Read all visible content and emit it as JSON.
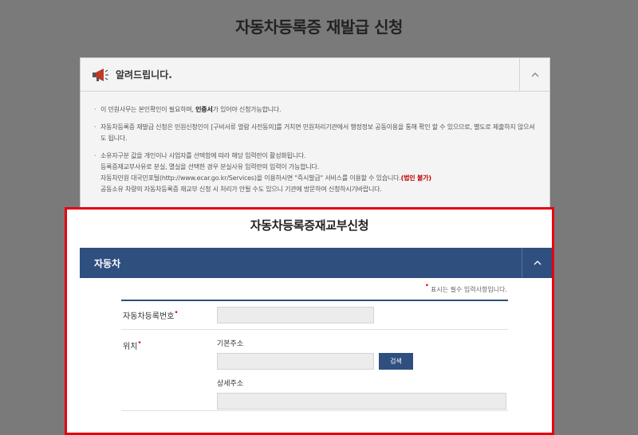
{
  "page": {
    "title": "자동차등록증 재발급 신청"
  },
  "notice": {
    "title": "알려드립니다.",
    "items": [
      {
        "pre": "이 민원사무는 본인확인이 필요하며, ",
        "bold": "인증서",
        "post": "가 있어야 신청가능합니다."
      },
      {
        "text": "자동차등록증 재발급 신청은 민원신청인이 [구비서류 열람 사전동의]를 거치면 민원처리기관에서 행정정보 공동이용을 통해 확인 할 수 있으므로, 별도로 제출하지 않으셔도 됩니다."
      },
      {
        "line1": "소유자구분 값을 개인이나 사업자를 선택함에 따라 해당 입력란이 활성화됩니다.",
        "line2": "등록증재교부사유로 분실, 멸실을 선택한 경우 분실사유 입력란의 입력이 가능합니다.",
        "line3": "자동차민원 대국민포털(http://www.ecar.go.kr/Services)을 이용하시면 \"즉시발급\" 서비스를 이용할 수 있습니다.",
        "line3_red": "(법인 불가)",
        "line4": "공동소유 차량의 자동차등록증 재교부 신청 시 처리가 안될 수도 있으니 기관에 방문하여 신청하시기바랍니다."
      }
    ]
  },
  "modal": {
    "title": "자동차등록증재교부신청",
    "section": "자동차",
    "required_note": "표시는 필수 입력사항입니다.",
    "required_mark": "•",
    "fields": {
      "reg_no_label": "자동차등록번호",
      "location_label": "위치",
      "base_address_label": "기본주소",
      "detail_address_label": "상세주소",
      "search_button": "검색"
    }
  },
  "icons": {
    "collapse": "chevron-up-icon",
    "notice": "megaphone-icon"
  },
  "colors": {
    "accent": "#2f4f7f",
    "highlight_border": "#e60012",
    "required": "#e60012"
  }
}
